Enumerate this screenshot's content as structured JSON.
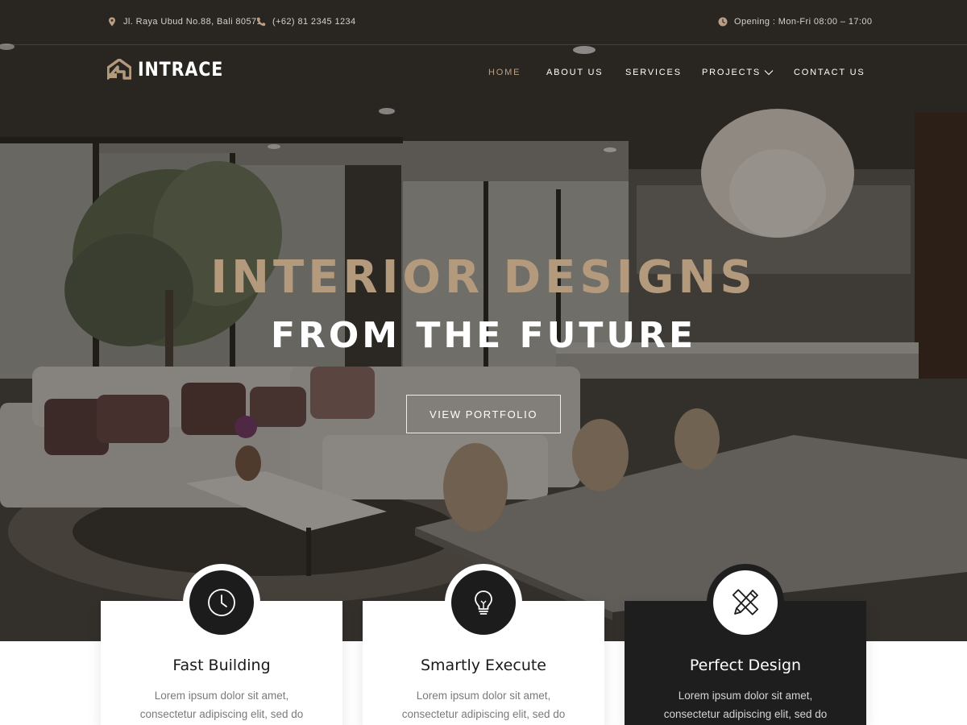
{
  "topbar": {
    "address": "Jl. Raya Ubud No.88, Bali 80571",
    "phone": "(+62) 81 2345 1234",
    "opening": "Opening : Mon-Fri 08:00 – 17:00"
  },
  "brand": {
    "name": "INTRACE",
    "accent_color": "#b49a7c"
  },
  "nav": {
    "items": [
      "HOME",
      "ABOUT US",
      "SERVICES",
      "PROJECTS",
      "CONTACT US"
    ],
    "active": "HOME"
  },
  "hero": {
    "headline": "INTERIOR DESIGNS",
    "subline": "FROM THE FUTURE",
    "cta_label": "VIEW PORTFOLIO"
  },
  "features": [
    {
      "title": "Fast Building",
      "text_line1": "Lorem ipsum dolor sit amet,",
      "text_line2": "consectetur adipiscing elit, sed do",
      "icon": "clock-icon"
    },
    {
      "title": "Smartly Execute",
      "text_line1": "Lorem ipsum dolor sit amet,",
      "text_line2": "consectetur adipiscing elit, sed do",
      "icon": "lightbulb-icon"
    },
    {
      "title": "Perfect Design",
      "text_line1": "Lorem ipsum dolor sit amet,",
      "text_line2": "consectetur adipiscing elit, sed do",
      "icon": "pencil-ruler-icon"
    }
  ]
}
